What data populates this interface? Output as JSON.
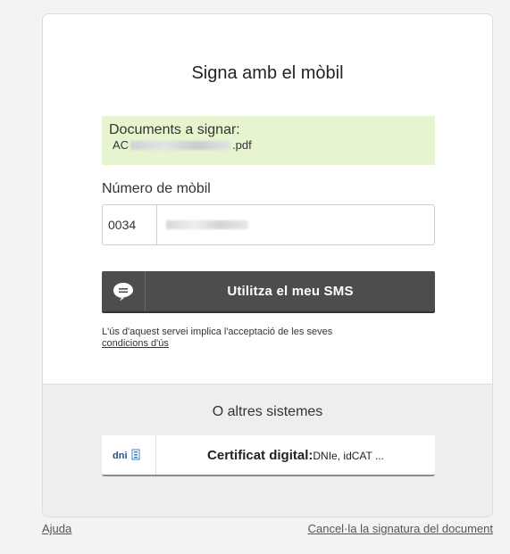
{
  "card": {
    "title": "Signa amb el mòbil",
    "documents": {
      "label": "Documents a signar:",
      "file_prefix": "AC",
      "file_suffix": ".pdf"
    },
    "phone": {
      "label": "Número de mòbil",
      "prefix": "0034"
    },
    "sms_button": {
      "label": "Utilitza el meu SMS",
      "icon": "speech-bubble-icon"
    },
    "terms": {
      "text": "L'ús d'aquest servei implica l'acceptació de les seves",
      "link": "condicions d'ús"
    },
    "alternatives": {
      "title": "O altres sistemes",
      "cert_button": {
        "bold": "Certificat digital:",
        "sub": "DNIe, idCAT ...",
        "logo": "dni"
      }
    }
  },
  "footer": {
    "help": "Ajuda",
    "cancel": "Cancel·la la signatura del document"
  },
  "colors": {
    "sms_button": "#4d4d4d",
    "docs_background": "#e6f5cf",
    "alt_background": "#eeeeee"
  }
}
